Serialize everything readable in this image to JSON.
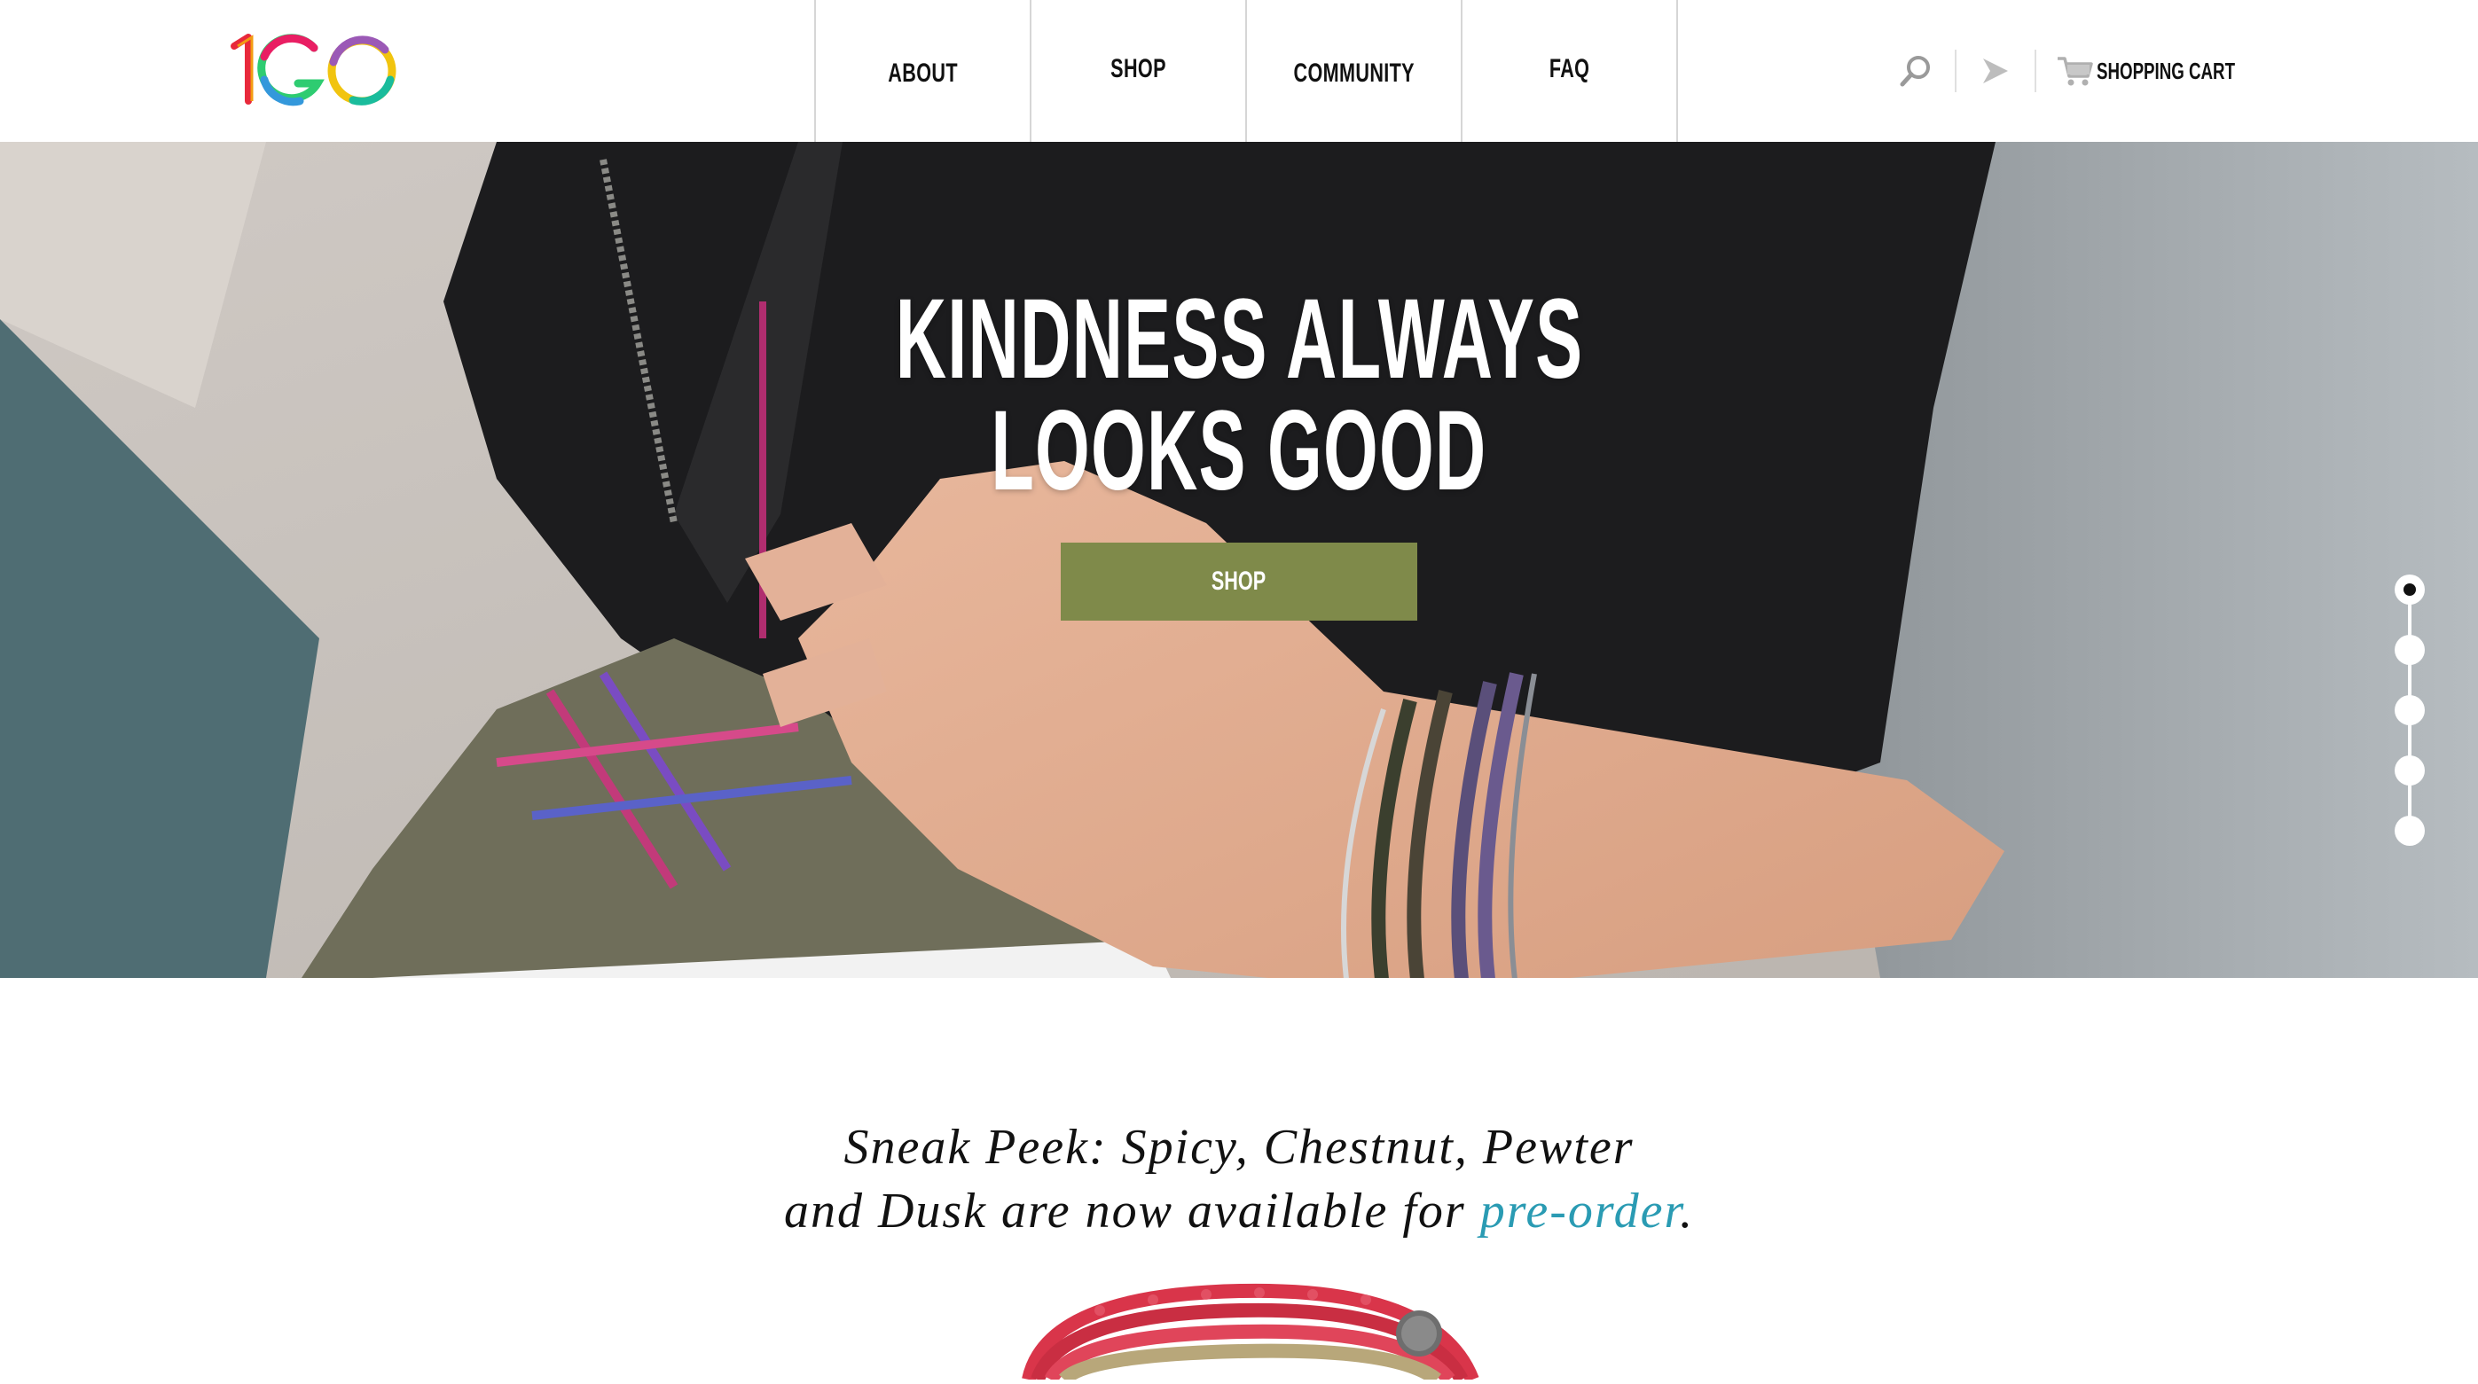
{
  "header": {
    "logo_text": "1GO",
    "nav": [
      "ABOUT",
      "SHOP",
      "COMMUNITY",
      "FAQ"
    ],
    "search_icon": "search-icon",
    "share_icon": "share-arrow-icon",
    "cart_icon": "cart-icon",
    "cart_label": "SHOPPING CART"
  },
  "hero": {
    "title_line1": "KINDNESS ALWAYS",
    "title_line2": "LOOKS GOOD",
    "button_label": "SHOP",
    "button_color": "#7f8a4a",
    "slides_total": 5,
    "active_slide": 1
  },
  "promo": {
    "line1": "Sneak Peek: Spicy, Chestnut, Pewter",
    "line2_prefix": "and Dusk are now available for ",
    "link_text": "pre-order",
    "line2_suffix": ".",
    "link_color": "#2a9bb3"
  }
}
